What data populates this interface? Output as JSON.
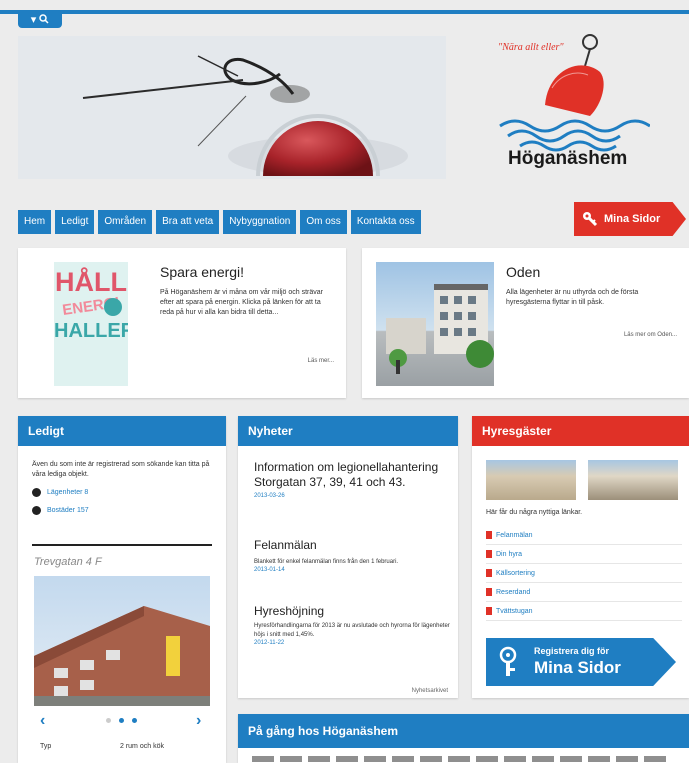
{
  "search": {
    "toggle_label": "▾ 🔍"
  },
  "logo": {
    "slogan": "Nära allt eller",
    "name": "Höganäshem"
  },
  "nav": {
    "items": [
      "Hem",
      "Ledigt",
      "Områden",
      "Bra att veta",
      "Nybyggnation",
      "Om oss",
      "Kontakta oss"
    ],
    "mina_sidor": "Mina Sidor"
  },
  "featured": [
    {
      "title": "Spara energi!",
      "body": "På Höganäshem är vi måna om vår miljö och strävar efter att spara på energin. Klicka på länken för att ta reda på hur vi alla kan bidra till detta...",
      "more": "Läs mer..."
    },
    {
      "title": "Oden",
      "body": "Alla lägenheter är nu uthyrda och de första hyresgästerna flyttar in till påsk.",
      "more": "Läs mer om Oden..."
    }
  ],
  "poster": {
    "line1": "HÅLL",
    "line2": "ENERGI",
    "line3": "HALLER"
  },
  "ledigt": {
    "title": "Ledigt",
    "intro": "Även du som inte är registrerad som sökande kan titta på våra lediga objekt.",
    "links": [
      "Lägenheter 8",
      "Bostäder 157"
    ],
    "listing_title": "Trevgatan 4 F",
    "row_label": "Typ",
    "row_value": "2 rum och kök"
  },
  "news": {
    "title": "Nyheter",
    "items": [
      {
        "title": "Information om legionellahantering Storgatan 37, 39, 41 och 43.",
        "date": "2013-03-26",
        "body": ""
      },
      {
        "title": "Felanmälan",
        "date": "2013-01-14",
        "body": "Blankett för enkel felanmälan finns från den 1 februari."
      },
      {
        "title": "Hyreshöjning",
        "date": "2012-11-22",
        "body": "Hyresförhandlingarna för 2013 är nu avslutade och hyrorna för lägenheter höjs i snitt med 1,45%."
      }
    ],
    "archive": "Nyhetsarkivet"
  },
  "tenants": {
    "title": "Hyresgäster",
    "intro": "Här får du några nyttiga länkar.",
    "links": [
      "Felanmälan",
      "Din hyra",
      "Källsortering",
      "Reserdand",
      "Tvättstugan"
    ],
    "register_line1": "Registrera dig för",
    "register_line2": "Mina Sidor"
  },
  "upcoming": {
    "title": "På gång hos Höganäshem"
  },
  "colors": {
    "accent_blue": "#1f7ec2",
    "accent_red": "#e03127"
  }
}
